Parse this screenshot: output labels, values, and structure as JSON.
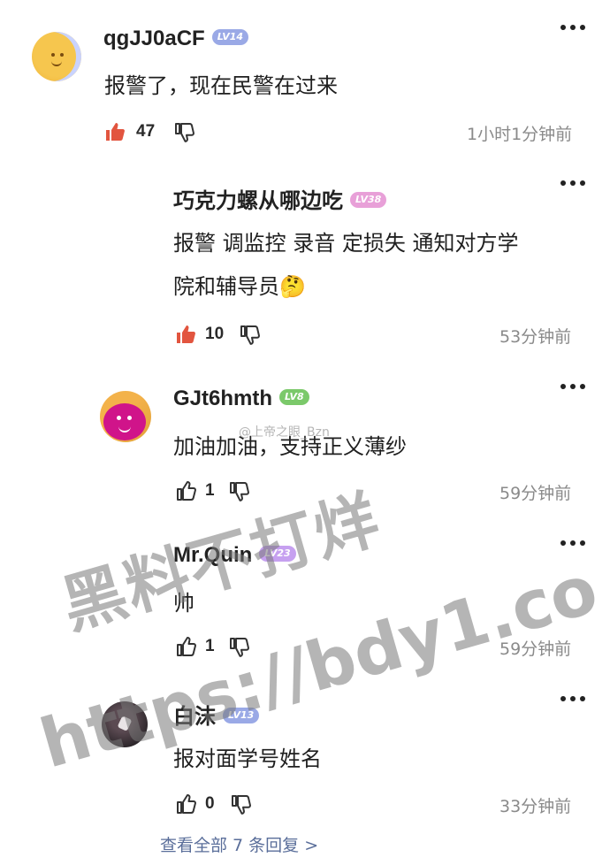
{
  "comments": [
    {
      "username": "qgJJ0aCF",
      "level": "LV14",
      "level_color": "#9aa9e6",
      "text_lines": [
        "报警了，现在民警在过来"
      ],
      "likes": "47",
      "liked": true,
      "time": "1小时1分钟前",
      "avatar_icon": "yellow-smiley-avatar"
    },
    {
      "username": "巧克力螺从哪边吃",
      "level": "LV38",
      "level_color": "#e8a0d8",
      "text_lines": [
        "报警 调监控 录音 定损失 通知对方学",
        "院和辅导员🤔"
      ],
      "likes": "10",
      "liked": true,
      "time": "53分钟前"
    },
    {
      "username": "GJt6hmth",
      "level": "LV8",
      "level_color": "#7bc96a",
      "text_lines": [
        "加油加油，支持正义薄纱"
      ],
      "likes": "1",
      "liked": false,
      "time": "59分钟前",
      "avatar_icon": "magenta-smiley-avatar"
    },
    {
      "username": "Mr.Quin",
      "level": "LV23",
      "level_color": "#c6a0f0",
      "text_lines": [
        "帅"
      ],
      "likes": "1",
      "liked": false,
      "time": "59分钟前"
    },
    {
      "username": "白沫",
      "level": "LV13",
      "level_color": "#9aa9e6",
      "text_lines": [
        "报对面学号姓名"
      ],
      "likes": "0",
      "liked": false,
      "time": "33分钟前",
      "avatar_icon": "dark-photo-avatar"
    }
  ],
  "footer": {
    "view_all": "查看全部 7 条回复 >"
  },
  "watermark": {
    "line1": "黑料不打烊",
    "line2": "https://bdy1.co",
    "small": "@上帝之眼_Bzn"
  },
  "colors": {
    "like_active": "#e2553f",
    "icon_gray": "#333333",
    "time_gray": "#8a8a8a",
    "link": "#5a6e9a"
  }
}
